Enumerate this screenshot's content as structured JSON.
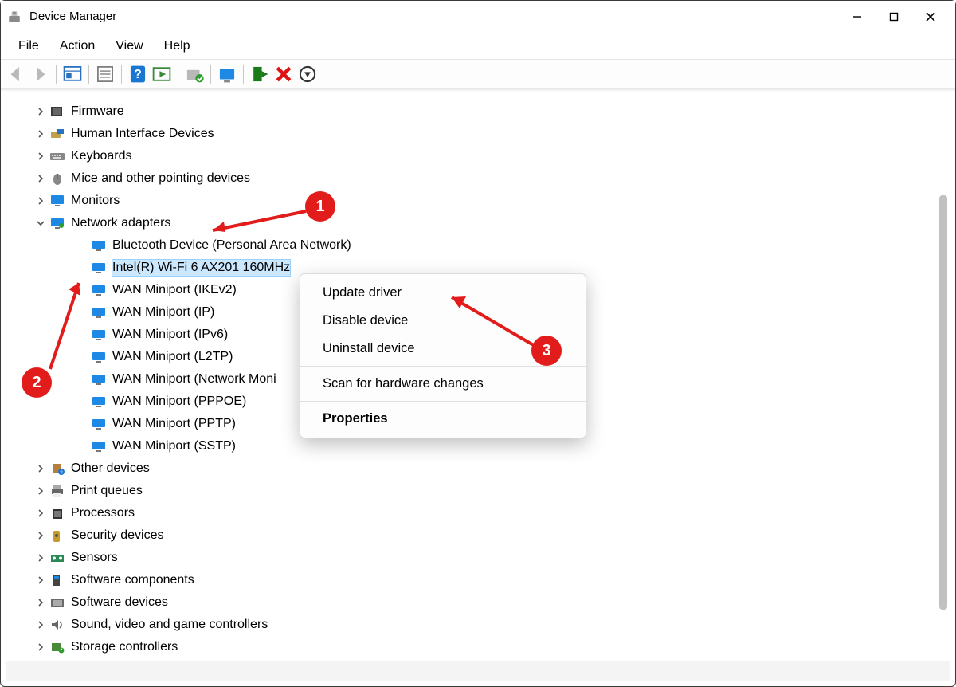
{
  "window": {
    "title": "Device Manager"
  },
  "menu": {
    "file": "File",
    "action": "Action",
    "view": "View",
    "help": "Help"
  },
  "tree": {
    "categories": [
      {
        "name": "Firmware",
        "icon": "firmware",
        "collapsed": true
      },
      {
        "name": "Human Interface Devices",
        "icon": "hid",
        "collapsed": true
      },
      {
        "name": "Keyboards",
        "icon": "keyboard",
        "collapsed": true
      },
      {
        "name": "Mice and other pointing devices",
        "icon": "mouse",
        "collapsed": true
      },
      {
        "name": "Monitors",
        "icon": "monitor",
        "collapsed": true
      },
      {
        "name": "Network adapters",
        "icon": "network",
        "collapsed": false,
        "children": [
          "Bluetooth Device (Personal Area Network)",
          "Intel(R) Wi-Fi 6 AX201 160MHz",
          "WAN Miniport (IKEv2)",
          "WAN Miniport (IP)",
          "WAN Miniport (IPv6)",
          "WAN Miniport (L2TP)",
          "WAN Miniport (Network Moni",
          "WAN Miniport (PPPOE)",
          "WAN Miniport (PPTP)",
          "WAN Miniport (SSTP)"
        ],
        "selected_child": 1
      },
      {
        "name": "Other devices",
        "icon": "other",
        "collapsed": true
      },
      {
        "name": "Print queues",
        "icon": "printer",
        "collapsed": true
      },
      {
        "name": "Processors",
        "icon": "cpu",
        "collapsed": true
      },
      {
        "name": "Security devices",
        "icon": "security",
        "collapsed": true
      },
      {
        "name": "Sensors",
        "icon": "sensors",
        "collapsed": true
      },
      {
        "name": "Software components",
        "icon": "swcomp",
        "collapsed": true
      },
      {
        "name": "Software devices",
        "icon": "swdev",
        "collapsed": true
      },
      {
        "name": "Sound, video and game controllers",
        "icon": "sound",
        "collapsed": true
      },
      {
        "name": "Storage controllers",
        "icon": "storage",
        "collapsed": true
      }
    ]
  },
  "context_menu": {
    "items": [
      {
        "label": "Update driver",
        "type": "item"
      },
      {
        "label": "Disable device",
        "type": "item"
      },
      {
        "label": "Uninstall device",
        "type": "item"
      },
      {
        "type": "divider"
      },
      {
        "label": "Scan for hardware changes",
        "type": "item"
      },
      {
        "type": "divider"
      },
      {
        "label": "Properties",
        "type": "item",
        "bold": true
      }
    ]
  },
  "annotations": {
    "b1": "1",
    "b2": "2",
    "b3": "3"
  }
}
